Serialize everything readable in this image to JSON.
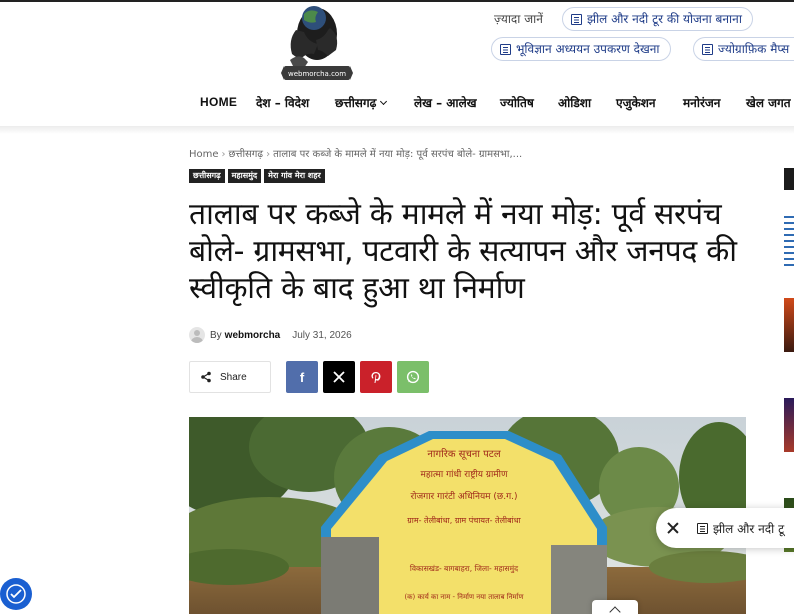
{
  "header": {
    "logo_text": "webmorcha.com",
    "suggestions_label": "ज़्यादा जानें",
    "suggestions": [
      {
        "label": "झील और नदी टूर की योजना बनाना"
      },
      {
        "label": "भूविज्ञान अध्ययन उपकरण देखना"
      },
      {
        "label": "ज्योग्राफ़िक मैप्स"
      }
    ]
  },
  "nav": {
    "items": [
      {
        "label": "HOME"
      },
      {
        "label": "देश – विदेश"
      },
      {
        "label": "छत्तीसगढ़"
      },
      {
        "label": "लेख – आलेख"
      },
      {
        "label": "ज्योतिष"
      },
      {
        "label": "ओडिशा"
      },
      {
        "label": "एजुकेशन"
      },
      {
        "label": "मनोरंजन"
      },
      {
        "label": "खेल जगत"
      }
    ]
  },
  "breadcrumb": {
    "home": "Home",
    "category": "छत्तीसगढ़",
    "current": "तालाब पर कब्जे के मामले में नया मोड़: पूर्व सरपंच बोले- ग्रामसभा,..."
  },
  "tags": [
    "छत्तीसगढ़",
    "महासमुंद",
    "मेरा गांव मेरा शहर"
  ],
  "article": {
    "title": "तालाब पर कब्जे के मामले में नया मोड़: पूर्व सरपंच बोले- ग्रामसभा, पटवारी के सत्यापन और जनपद की स्वीकृति के बाद हुआ था निर्माण",
    "by": "By",
    "author": "webmorcha",
    "date": "July 31, 2026"
  },
  "share": {
    "label": "Share",
    "buttons": [
      {
        "name": "facebook",
        "glyph": "f",
        "color": "#516eab"
      },
      {
        "name": "x",
        "glyph": "X",
        "color": "#000000"
      },
      {
        "name": "pinterest",
        "glyph": "P",
        "color": "#ca212a"
      },
      {
        "name": "whatsapp",
        "glyph": "W",
        "color": "#7bbf6a"
      }
    ]
  },
  "signboard": {
    "line1": "नागरिक सूचना पटल",
    "line2": "महात्मा गांधी राष्ट्रीय ग्रामीण",
    "line3": "रोजगार गारंटी अधिनियम (छ.ग.)",
    "line4": "ग्राम- तेलीबांधा, ग्राम पंचायत- तेलीबांधा",
    "line5": "विकासखंड- बागबाहरा, जिला- महासमुंद",
    "line6": "(क) कार्य का नाम - निर्माण नया तालाब निर्माण"
  },
  "floating_bar": {
    "chip_label": "झील और नदी टू"
  },
  "colors": {
    "accent_blue": "#1f3c88",
    "a11y_blue": "#1a5fd1",
    "board_yellow": "#f3e06a",
    "board_blue": "#2d8ec9"
  }
}
